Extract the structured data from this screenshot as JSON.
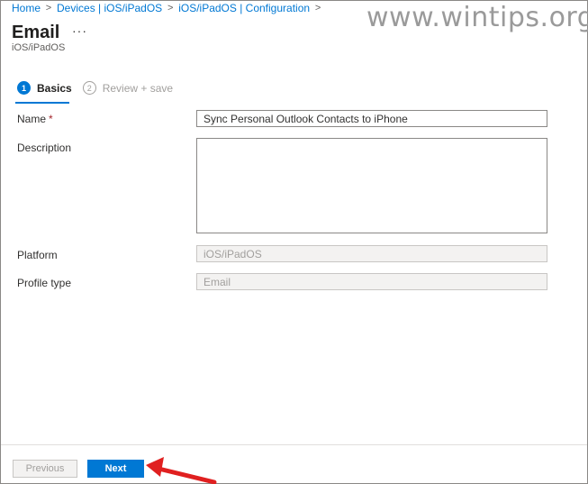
{
  "breadcrumb": {
    "items": [
      "Home",
      "Devices | iOS/iPadOS",
      "iOS/iPadOS | Configuration"
    ],
    "separator": ">"
  },
  "watermark": "www.wintips.org",
  "header": {
    "title": "Email",
    "more": "···",
    "subtitle": "iOS/iPadOS"
  },
  "steps": [
    {
      "number": "1",
      "label": "Basics",
      "active": true
    },
    {
      "number": "2",
      "label": "Review + save",
      "active": false
    }
  ],
  "form": {
    "name_label": "Name",
    "required_marker": "*",
    "name_value": "Sync Personal Outlook Contacts to iPhone",
    "description_label": "Description",
    "description_value": "",
    "platform_label": "Platform",
    "platform_value": "iOS/iPadOS",
    "profile_type_label": "Profile type",
    "profile_type_value": "Email"
  },
  "footer": {
    "previous_label": "Previous",
    "next_label": "Next"
  },
  "colors": {
    "accent": "#0078d4",
    "annotation_arrow": "#e02020"
  }
}
